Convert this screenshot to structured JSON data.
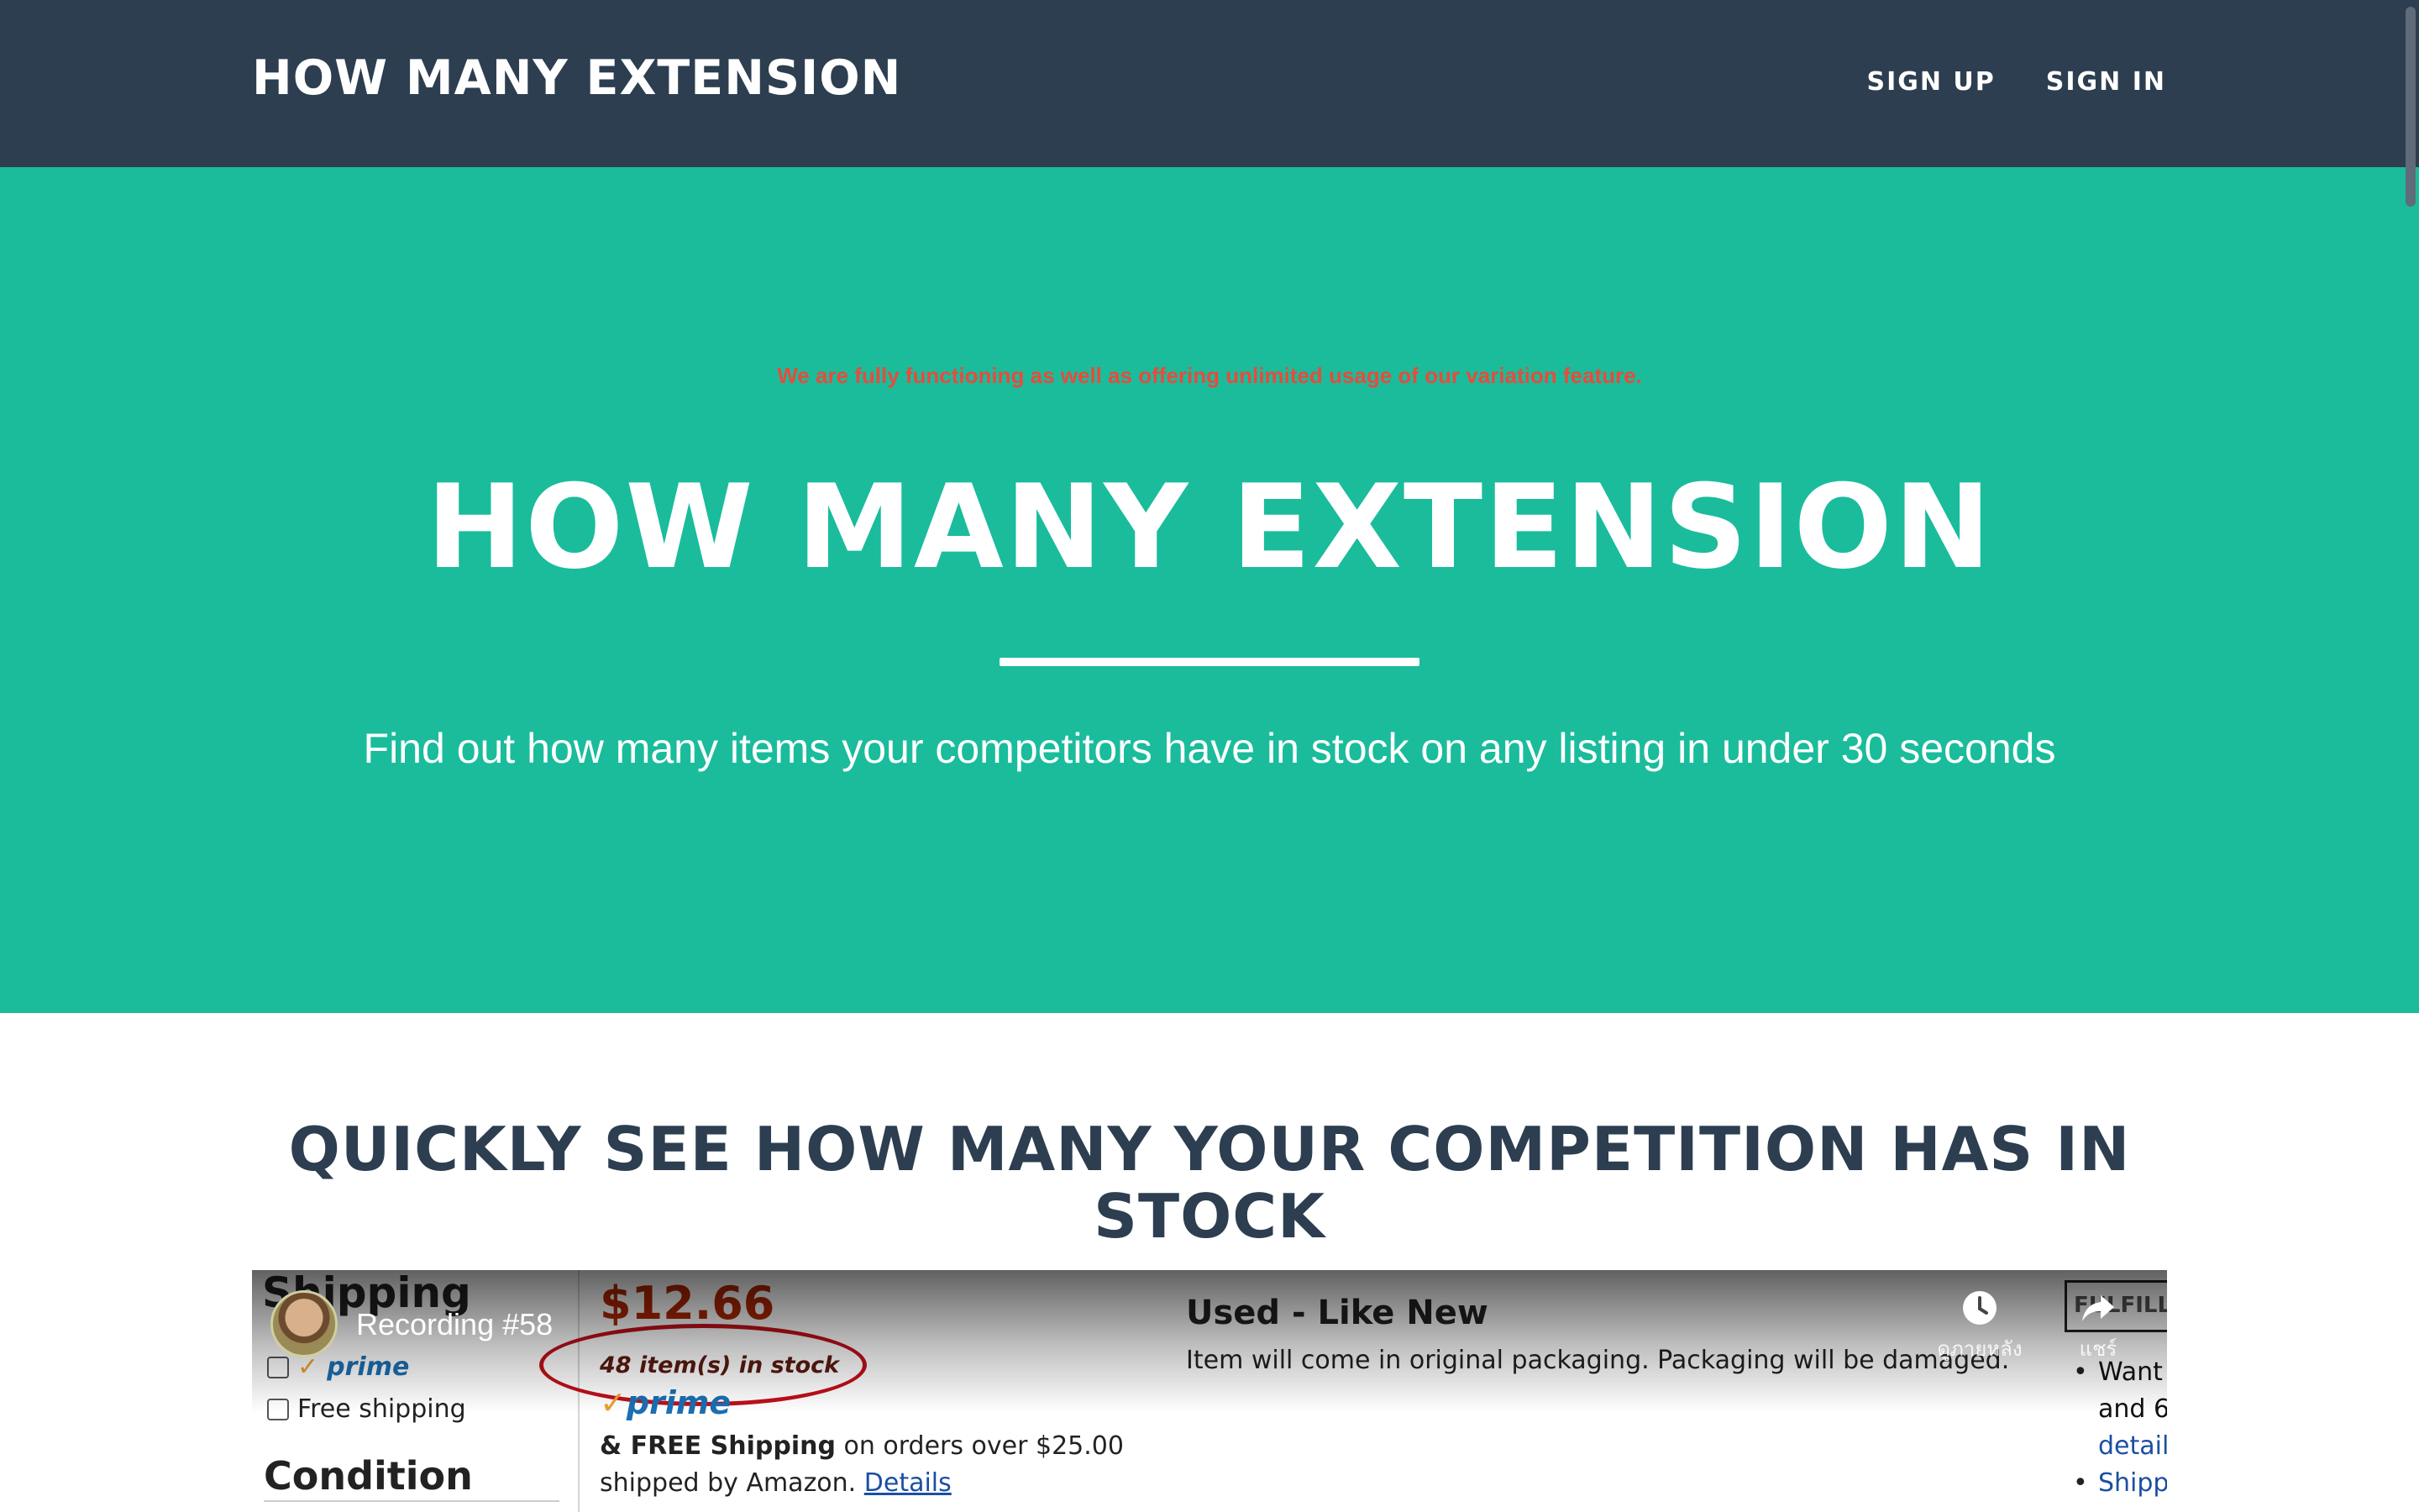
{
  "navbar": {
    "brand": "HOW MANY EXTENSION",
    "links": [
      "SIGN UP",
      "SIGN IN"
    ]
  },
  "hero": {
    "notice": "We are fully functioning as well as offering unlimited usage of our variation feature.",
    "title": "HOW MANY EXTENSION",
    "tagline": "Find out how many items your competitors have in stock on any listing in under 30 seconds"
  },
  "section": {
    "title": "QUICKLY SEE HOW MANY YOUR COMPETITION HAS IN STOCK"
  },
  "video": {
    "recording_title": "Recording #58",
    "watch_later_label": "ดูภายหลัง",
    "share_label": "แชร์",
    "content": {
      "shipping_heading": "Shipping",
      "prime_label": "prime",
      "free_shipping_label": "Free shipping",
      "condition_heading": "Condition",
      "price": "$12.66",
      "stock_text": "48 item(s) in stock",
      "prime_logo": "prime",
      "free_shipping_bold": "& FREE Shipping",
      "free_shipping_rest": " on orders over $25.00",
      "shipped_by": "shipped by Amazon. ",
      "details_link": "Details",
      "condition_value": "Used - Like New",
      "condition_note": "Item will come in original packaging. Packaging will be damaged.",
      "fulfillment_box": "FULFILLM",
      "bullets": [
        "Want",
        "and 6",
        "detail",
        "Shipp"
      ]
    }
  },
  "colors": {
    "navbar_bg": "#2c3e50",
    "hero_bg": "#1abc9c",
    "notice": "#e74c3c",
    "heading": "#2c3e50"
  },
  "icons": {
    "watch_later": "clock-icon",
    "share": "share-arrow-icon"
  }
}
